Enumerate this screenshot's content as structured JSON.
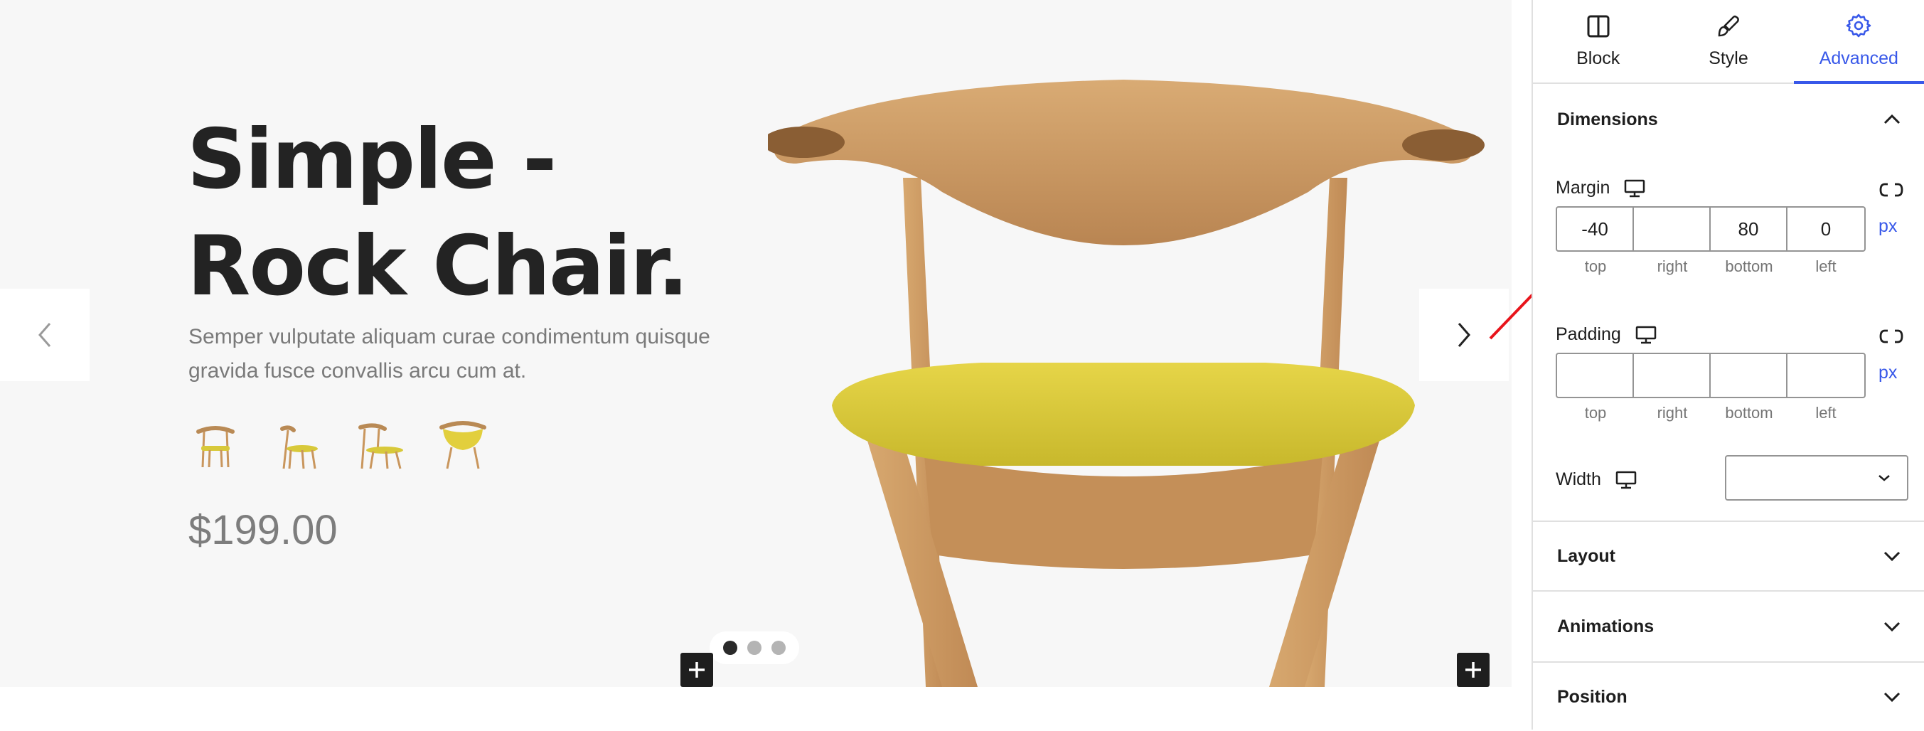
{
  "canvas": {
    "title_line1": "Simple -",
    "title_line2": "Rock Chair.",
    "description": "Semper vulputate aliquam curae condimentum quisque gravida fusce convallis arcu cum at.",
    "price": "$199.00",
    "thumbnails": [
      "chair-thumbnail-1",
      "chair-thumbnail-2",
      "chair-thumbnail-3",
      "chair-thumbnail-4"
    ],
    "slide_dots": [
      true,
      false,
      false
    ]
  },
  "panel": {
    "tabs": [
      {
        "label": "Block",
        "icon": "block-icon"
      },
      {
        "label": "Style",
        "icon": "brush-icon"
      },
      {
        "label": "Advanced",
        "icon": "gear-icon",
        "active": true
      }
    ],
    "dimensions": {
      "title": "Dimensions",
      "margin": {
        "label": "Margin",
        "top": "-40",
        "right": "",
        "bottom": "80",
        "left": "0",
        "unit": "px"
      },
      "padding": {
        "label": "Padding",
        "top": "",
        "right": "",
        "bottom": "",
        "left": "",
        "unit": "px"
      },
      "sides": {
        "top": "top",
        "right": "right",
        "bottom": "bottom",
        "left": "left"
      },
      "width": {
        "label": "Width",
        "value": ""
      }
    },
    "sections": [
      "Layout",
      "Animations",
      "Position"
    ]
  },
  "colors": {
    "accent": "#3858e9",
    "annotation_arrow": "#e8141b",
    "chair_seat": "#d8c93a",
    "wood": "#c9965d"
  }
}
